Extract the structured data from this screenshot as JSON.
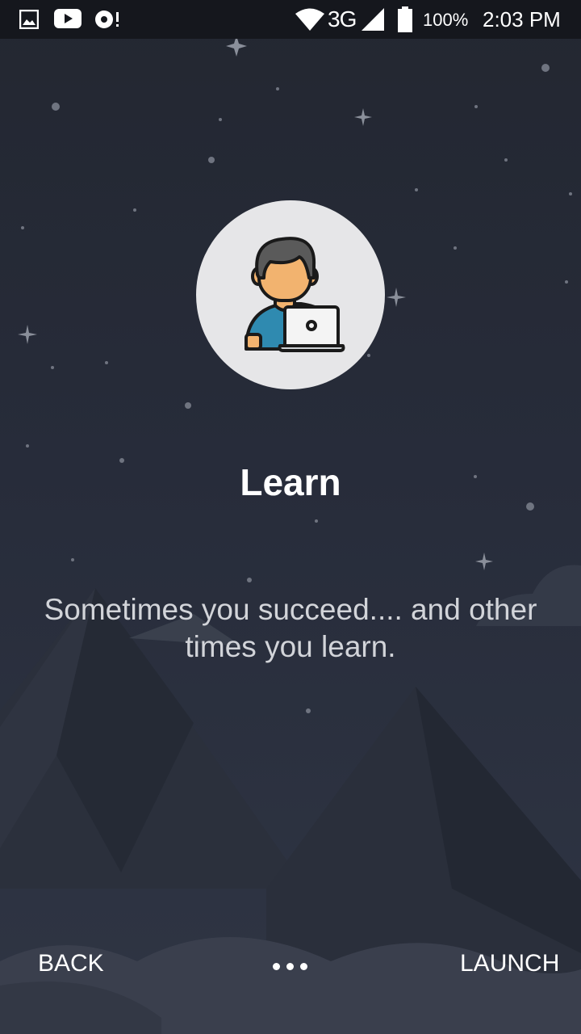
{
  "status_bar": {
    "left_icons": [
      "gallery-icon",
      "youtube-icon",
      "sync-alert-icon"
    ],
    "right_icons": [
      "wifi-icon",
      "signal-icon",
      "battery-icon"
    ],
    "network": "3G",
    "battery": "100%",
    "time": "2:03 PM"
  },
  "slide": {
    "illustration": "person-with-laptop-icon",
    "title": "Learn",
    "description": "Sometimes you succeed.... and other times you learn."
  },
  "navigation": {
    "back_label": "BACK",
    "launch_label": "LAUNCH",
    "pager_dots": 3
  },
  "colors": {
    "background": "#252a36",
    "circle": "#e6e6e8",
    "skin": "#f2b36f",
    "shirt": "#2f8ab0",
    "hair": "#5a5a5a"
  }
}
